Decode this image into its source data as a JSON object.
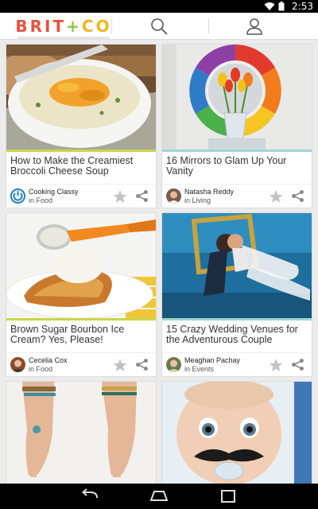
{
  "status_bar": {
    "time": "2:53"
  },
  "header": {
    "logo_brit": "BRIT",
    "logo_plus": "+",
    "logo_co": "CO"
  },
  "cards": [
    {
      "title": "How to Make the Creamiest Broccoli Cheese Soup",
      "author": "Cooking Classy",
      "category": "in Food",
      "accent": "#c9d64a"
    },
    {
      "title": "16 Mirrors to Glam Up Your Vanity",
      "author": "Natasha Reddy",
      "category": "in Living",
      "accent": "#9fd7d2"
    },
    {
      "title": "Brown Sugar Bourbon Ice Cream? Yes, Please!",
      "author": "Cecelia Cox",
      "category": "in Food",
      "accent": "#c9d64a"
    },
    {
      "title": "15 Crazy Wedding Venues for the Adventurous Couple",
      "author": "Meaghan Pachay",
      "category": "in Events",
      "accent": "#9fd7d2"
    }
  ],
  "colors": {
    "brit_red": "#e8533f",
    "plus_green": "#8cc63f",
    "co_yellow": "#f3b51b",
    "icon_gray": "#888888"
  }
}
